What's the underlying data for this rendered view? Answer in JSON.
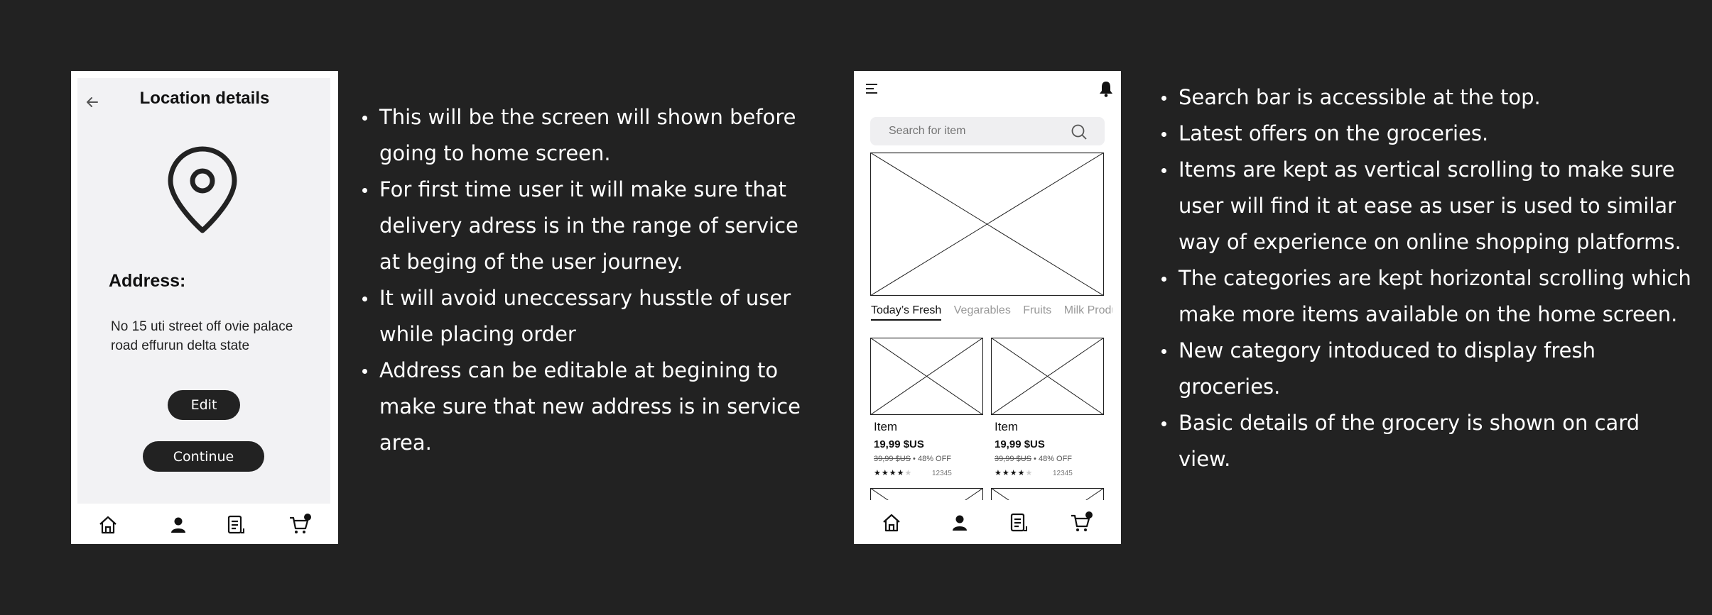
{
  "location_screen": {
    "title": "Location details",
    "address_label": "Address:",
    "address_text": "No 15 uti street off ovie palace road effurun delta state",
    "edit_button": "Edit",
    "continue_button": "Continue",
    "icons": [
      "back-arrow-icon",
      "location-pin-icon",
      "home-icon",
      "user-icon",
      "orders-icon",
      "cart-icon"
    ]
  },
  "notes_left": [
    "This will be the screen will shown before going to home screen.",
    "For first time user it will make sure that delivery adress is in the range of service at beging of the user journey.",
    "It will avoid uneccessary husstle  of user while placing order",
    "Address can be editable at begining to make sure that new address is in service area."
  ],
  "home_screen": {
    "search_placeholder": "Search for item",
    "tabs": [
      "Today’s Fresh",
      "Vegarables",
      "Fruits",
      "Milk Product"
    ],
    "products": [
      {
        "name": "Item",
        "price": "19,99 $US",
        "old_price": "39,99 $US",
        "discount": "• 48% OFF",
        "rating": 4,
        "reviews": "12345"
      },
      {
        "name": "Item",
        "price": "19,99 $US",
        "old_price": "39,99 $US",
        "discount": "• 48% OFF",
        "rating": 4,
        "reviews": "12345"
      }
    ],
    "icons": [
      "menu-icon",
      "bell-icon",
      "search-icon",
      "home-icon",
      "user-icon",
      "orders-icon",
      "cart-icon"
    ]
  },
  "notes_right": [
    "Search bar  is accessible at the top.",
    "Latest offers on the groceries.",
    "Items are kept as vertical scrolling to make sure user will find it at ease as user is used to similar way of experience on online shopping platforms.",
    "The categories are kept horizontal scrolling which make more items available on the home screen.",
    "New category intoduced to display fresh groceries.",
    "Basic details of the grocery is shown on card view."
  ],
  "colors": {
    "background": "#222222",
    "phone_bg": "#ffffff",
    "panel_bg": "#f2f2f4",
    "button_bg": "#222222"
  }
}
